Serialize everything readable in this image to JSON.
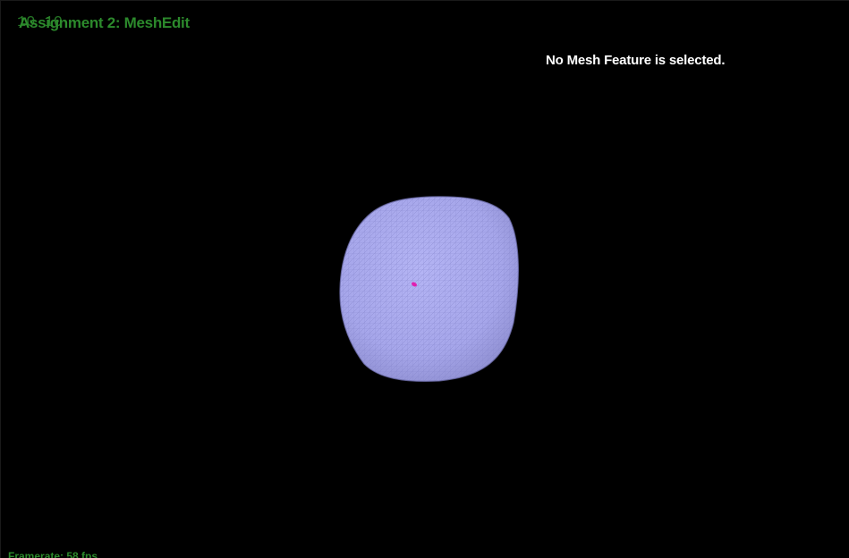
{
  "app": {
    "title": "Assignment 2: MeshEdit",
    "overlay_digits": "10 10"
  },
  "status": {
    "selection_message": "No Mesh Feature is selected."
  },
  "footer": {
    "framerate_label": "Framerate: 58 fps"
  },
  "colors": {
    "background": "#000000",
    "hud_text": "#2c8a2c",
    "status_text": "#ffffff",
    "mesh_fill": "#a9a9ee",
    "mesh_wire": "#7f7fc8",
    "selection_marker": "#e020b0"
  },
  "icons": {
    "mesh": "mesh-surface-icon",
    "selection_marker": "selected-vertex-icon"
  }
}
